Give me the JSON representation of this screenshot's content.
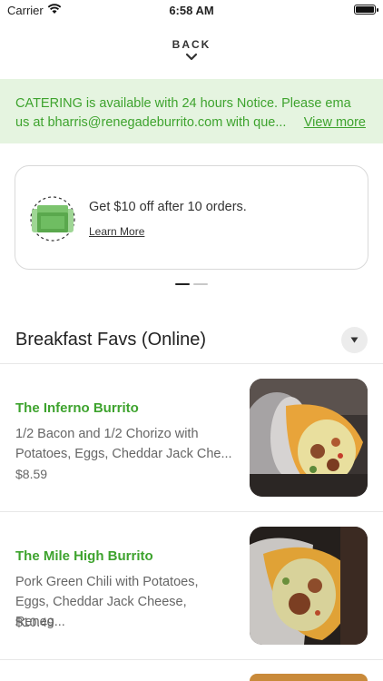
{
  "status_bar": {
    "carrier": "Carrier",
    "time": "6:58 AM"
  },
  "nav": {
    "back_label": "BACK"
  },
  "banner": {
    "text": "CATERING is available with 24 hours Notice. Please ema\nus at bharris@renegadeburrito.com with que...",
    "view_more": "View more"
  },
  "promo": {
    "title": "Get $10 off after 10 orders.",
    "link": "Learn More",
    "icon": "box-icon"
  },
  "pager": {
    "count": 2,
    "active": 0
  },
  "section": {
    "title": "Breakfast Favs (Online)"
  },
  "items": [
    {
      "name": "The Inferno Burrito",
      "description": "1/2 Bacon and 1/2 Chorizo  with\nPotatoes, Eggs, Cheddar Jack Che...",
      "price": "$8.59"
    },
    {
      "name": "The Mile High Burrito",
      "description": "Pork Green Chili with Potatoes,\nEggs, Cheddar Jack Cheese, Reneg...",
      "price": "$10.49"
    }
  ],
  "colors": {
    "accent": "#3ea32e",
    "banner_bg": "#e5f4e0"
  }
}
